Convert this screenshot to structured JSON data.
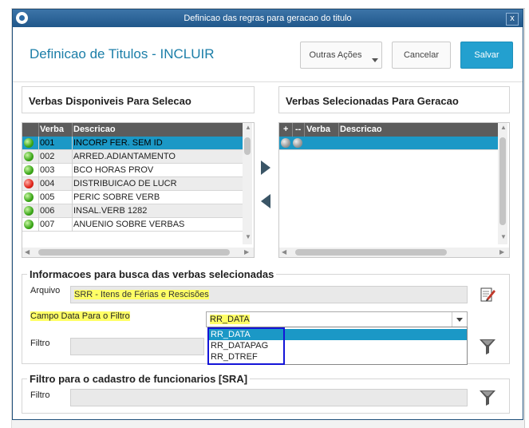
{
  "window": {
    "title": "Definicao das regras para geracao do titulo",
    "close_label": "x"
  },
  "header": {
    "page_title": "Definicao de Titulos - INCLUIR",
    "outras_label": "Outras Ações",
    "cancel_label": "Cancelar",
    "save_label": "Salvar"
  },
  "available": {
    "title": "Verbas Disponiveis Para Selecao",
    "columns": [
      "Verba",
      "Descricao"
    ],
    "rows": [
      {
        "status": "green",
        "verba": "001",
        "descricao": "INCORP FER. SEM ID"
      },
      {
        "status": "green",
        "verba": "002",
        "descricao": "ARRED.ADIANTAMENTO"
      },
      {
        "status": "green",
        "verba": "003",
        "descricao": "BCO HORAS PROV"
      },
      {
        "status": "red",
        "verba": "004",
        "descricao": "DISTRIBUICAO DE LUCR"
      },
      {
        "status": "green",
        "verba": "005",
        "descricao": "PERIC SOBRE VERB"
      },
      {
        "status": "green",
        "verba": "006",
        "descricao": "INSAL.VERB 1282"
      },
      {
        "status": "green",
        "verba": "007",
        "descricao": "ANUENIO SOBRE VERBAS"
      }
    ],
    "selected_row": 0
  },
  "selected": {
    "title": "Verbas Selecionadas Para Geracao",
    "columns": [
      "+",
      "--",
      "Verba",
      "Descricao"
    ]
  },
  "busca": {
    "title": "Informacoes para busca das verbas selecionadas",
    "arquivo_label": "Arquivo",
    "arquivo_value": "SRR - Itens de Férias e Rescisões",
    "campo_label": "Campo Data Para o Filtro",
    "campo_value": "RR_DATA",
    "options": [
      "RR_DATA",
      "RR_DATAPAG",
      "RR_DTREF"
    ],
    "filtro_label": "Filtro"
  },
  "sra": {
    "title": "Filtro para o cadastro de funcionarios [SRA]",
    "filtro_label": "Filtro"
  },
  "icons": {
    "edit": "edit-icon",
    "filter": "filter-icon",
    "move_right": "arrow-right-icon",
    "move_left": "arrow-left-icon"
  }
}
